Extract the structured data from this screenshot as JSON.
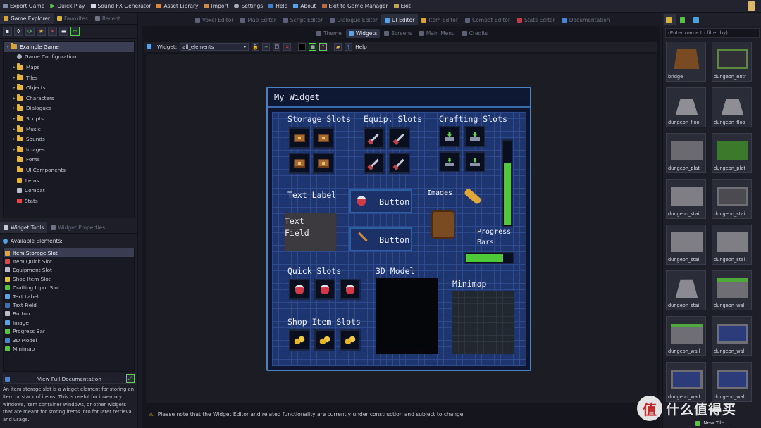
{
  "menu": [
    "Export Game",
    "Quick Play",
    "Sound FX Generator",
    "Asset Library",
    "Import",
    "Settings",
    "Help",
    "About",
    "Exit to Game Manager",
    "Exit"
  ],
  "editor_tabs": [
    {
      "label": "Voxel Editor",
      "active": false
    },
    {
      "label": "Map Editor",
      "active": false
    },
    {
      "label": "Script Editor",
      "active": false
    },
    {
      "label": "Dialogue Editor",
      "active": false
    },
    {
      "label": "UI Editor",
      "active": true
    },
    {
      "label": "Item Editor",
      "active": false
    },
    {
      "label": "Combat Editor",
      "active": false
    },
    {
      "label": "Stats Editor",
      "active": false
    },
    {
      "label": "Documentation",
      "active": false
    }
  ],
  "left": {
    "tabs": [
      "Game Explorer",
      "Favorites",
      "Recent"
    ],
    "tree": [
      {
        "label": "Example Game",
        "kind": "root"
      },
      {
        "label": "Game Configuration",
        "kind": "gear"
      },
      {
        "label": "Maps",
        "kind": "folder"
      },
      {
        "label": "Tiles",
        "kind": "folder"
      },
      {
        "label": "Objects",
        "kind": "folder"
      },
      {
        "label": "Characters",
        "kind": "folder"
      },
      {
        "label": "Dialogues",
        "kind": "folder"
      },
      {
        "label": "Scripts",
        "kind": "folder"
      },
      {
        "label": "Music",
        "kind": "folder"
      },
      {
        "label": "Sounds",
        "kind": "folder"
      },
      {
        "label": "Images",
        "kind": "folder"
      },
      {
        "label": "Fonts",
        "kind": "folder-plain"
      },
      {
        "label": "UI Components",
        "kind": "folder-plain"
      },
      {
        "label": "Items",
        "kind": "item"
      },
      {
        "label": "Combat",
        "kind": "combat"
      },
      {
        "label": "Stats",
        "kind": "stats"
      }
    ],
    "tools_tabs": [
      "Widget Tools",
      "Widget Properties"
    ],
    "available_header": "Available Elements:",
    "elements": [
      "Item Storage Slot",
      "Item Quick Slot",
      "Equipment Slot",
      "Shop Item Slot",
      "Crafting Input Slot",
      "Text Label",
      "Text Field",
      "Button",
      "Image",
      "Progress Bar",
      "3D Model",
      "Minimap"
    ],
    "docs_button": "View Full Documentation",
    "description": "An item storage slot is a widget element for storing an item or stack of items. This is useful for inventory windows, item container windows, or other widgets that are meant for storing items into for later retrieval and usage."
  },
  "center": {
    "subtabs": [
      {
        "label": "Theme",
        "active": false
      },
      {
        "label": "Widgets",
        "active": true
      },
      {
        "label": "Screens",
        "active": false
      },
      {
        "label": "Main Menu",
        "active": false
      },
      {
        "label": "Credits",
        "active": false
      }
    ],
    "widget_label": "Widget:",
    "widget_value": "all_elements",
    "help_label": "Help",
    "notice": "Please note that the Widget Editor and related functionality are currently under construction and subject to change."
  },
  "widget": {
    "title": "My Widget",
    "storage_slots": "Storage Slots",
    "equip_slots": "Equip. Slots",
    "crafting_slots": "Crafting Slots",
    "text_label": "Text Label",
    "text_field_1": "Text",
    "text_field_2": "Field",
    "button_1": "Button",
    "button_2": "Button",
    "images": "Images",
    "progress_1": "Progress",
    "progress_2": "Bars",
    "quick_slots": "Quick Slots",
    "model_3d": "3D Model",
    "minimap": "Minimap",
    "shop_item_slots": "Shop Item Slots",
    "progress_horizontal": 0.8,
    "progress_vertical": 0.75
  },
  "right": {
    "filter_placeholder": "(Enter name to filter by)",
    "tiles": [
      "bridge",
      "dungeon_entr",
      "dungeon_floo",
      "dungeon_floo",
      "dungeon_plat",
      "dungeon_plat",
      "dungeon_stai",
      "dungeon_stai",
      "dungeon_stai",
      "dungeon_stai",
      "dungeon_stai",
      "dungeon_wall",
      "dungeon_wall",
      "dungeon_wall",
      "dungeon_wall",
      "dungeon_wall"
    ],
    "new_tile": "New Tile...",
    "watermark_text": "什么值得买",
    "watermark_glyph": "值"
  }
}
